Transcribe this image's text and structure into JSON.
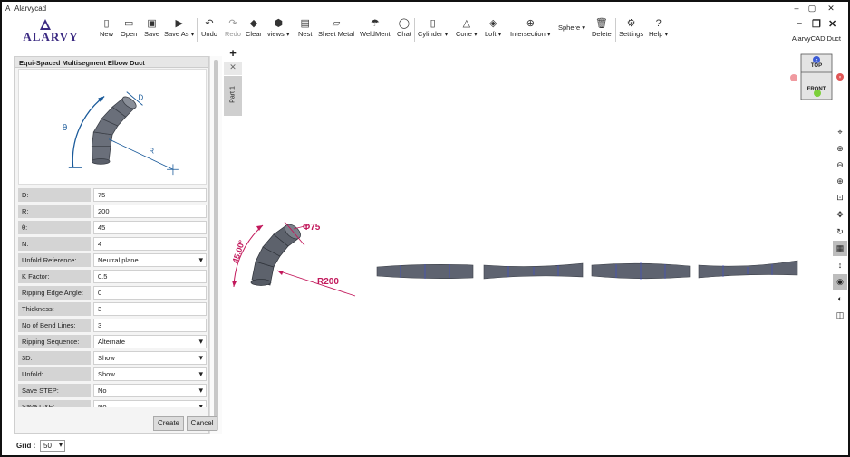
{
  "window": {
    "title": "Alarvycad",
    "app_icon": "A",
    "minimize": "–",
    "maximize": "▢",
    "close": "✕"
  },
  "logo": {
    "text": "ALARVY"
  },
  "toolbar": [
    {
      "id": "new",
      "label": "New",
      "icon": "▯"
    },
    {
      "id": "open",
      "label": "Open",
      "icon": "▭"
    },
    {
      "id": "save",
      "label": "Save",
      "icon": "▣"
    },
    {
      "id": "saveas",
      "label": "Save As ▾",
      "icon": "▶"
    },
    {
      "id": "undo",
      "label": "Undo",
      "icon": "↶"
    },
    {
      "id": "redo",
      "label": "Redo",
      "icon": "↷"
    },
    {
      "id": "clear",
      "label": "Clear",
      "icon": "◆"
    },
    {
      "id": "views",
      "label": "views ▾",
      "icon": "⬢"
    },
    {
      "id": "nest",
      "label": "Nest",
      "icon": "▤"
    },
    {
      "id": "sheetmetal",
      "label": "Sheet Metal",
      "icon": "▱"
    },
    {
      "id": "weldment",
      "label": "WeldMent",
      "icon": "☂"
    },
    {
      "id": "chat",
      "label": "Chat",
      "icon": "◯"
    },
    {
      "id": "cylinder",
      "label": "Cylinder ▾",
      "icon": "▯"
    },
    {
      "id": "cone",
      "label": "Cone ▾",
      "icon": "△"
    },
    {
      "id": "loft",
      "label": "Loft ▾",
      "icon": "◈"
    },
    {
      "id": "intersection",
      "label": "Intersection ▾",
      "icon": "⊕"
    },
    {
      "id": "sphere",
      "label": "Sphere ▾",
      "icon": ""
    },
    {
      "id": "delete",
      "label": "Delete",
      "icon": "🗑"
    },
    {
      "id": "settings",
      "label": "Settings",
      "icon": "⚙"
    },
    {
      "id": "help",
      "label": "Help ▾",
      "icon": "?"
    }
  ],
  "ribbon_right": {
    "label": "AlarvyCAD Duct",
    "minimize": "–",
    "restore": "❐",
    "close": "✕"
  },
  "panel": {
    "title": "Equi-Spaced Multisegment Elbow Duct",
    "collapse": "–",
    "diagram_labels": {
      "d": "D",
      "theta": "θ",
      "r": "R"
    },
    "fields": [
      {
        "label": "D:",
        "value": "75",
        "type": "text"
      },
      {
        "label": "R:",
        "value": "200",
        "type": "text"
      },
      {
        "label": "θ:",
        "value": "45",
        "type": "text"
      },
      {
        "label": "N:",
        "value": "4",
        "type": "text"
      },
      {
        "label": "Unfold Reference:",
        "value": "Neutral plane",
        "type": "select"
      },
      {
        "label": "K Factor:",
        "value": "0.5",
        "type": "text"
      },
      {
        "label": "Ripping Edge Angle:",
        "value": "0",
        "type": "text"
      },
      {
        "label": "Thickness:",
        "value": "3",
        "type": "text"
      },
      {
        "label": "No of Bend Lines:",
        "value": "3",
        "type": "text"
      },
      {
        "label": "Ripping Sequence:",
        "value": "Alternate",
        "type": "select"
      },
      {
        "label": "3D:",
        "value": "Show",
        "type": "select"
      },
      {
        "label": "Unfold:",
        "value": "Show",
        "type": "select"
      },
      {
        "label": "Save STEP:",
        "value": "No",
        "type": "select"
      },
      {
        "label": "Save DXF:",
        "value": "No",
        "type": "select"
      }
    ],
    "create_label": "Create",
    "cancel_label": "Cancel"
  },
  "part_tab": {
    "add": "+",
    "close": "✕",
    "label": "Part 1"
  },
  "viewcube": {
    "top": "TOP",
    "front": "FRONT",
    "z": "Z"
  },
  "model": {
    "dia_label": "Φ75",
    "radius_label": "R200",
    "angle_label": "45.00°"
  },
  "right_tools": [
    {
      "name": "mouse-icon",
      "glyph": "⌖"
    },
    {
      "name": "zoom-in-icon",
      "glyph": "⊕"
    },
    {
      "name": "zoom-out-icon",
      "glyph": "⊖"
    },
    {
      "name": "zoom-fit-icon",
      "glyph": "⊕"
    },
    {
      "name": "zoom-window-icon",
      "glyph": "⊡"
    },
    {
      "name": "pan-icon",
      "glyph": "✥"
    },
    {
      "name": "rotate-icon",
      "glyph": "↻"
    },
    {
      "name": "grid-icon",
      "glyph": "▦"
    },
    {
      "name": "vertical-icon",
      "glyph": "↕"
    },
    {
      "name": "eye-icon",
      "glyph": "◉"
    },
    {
      "name": "contrast-icon",
      "glyph": "◐"
    },
    {
      "name": "layers-icon",
      "glyph": "◫"
    }
  ],
  "grid": {
    "label": "Grid :",
    "value": "50"
  }
}
